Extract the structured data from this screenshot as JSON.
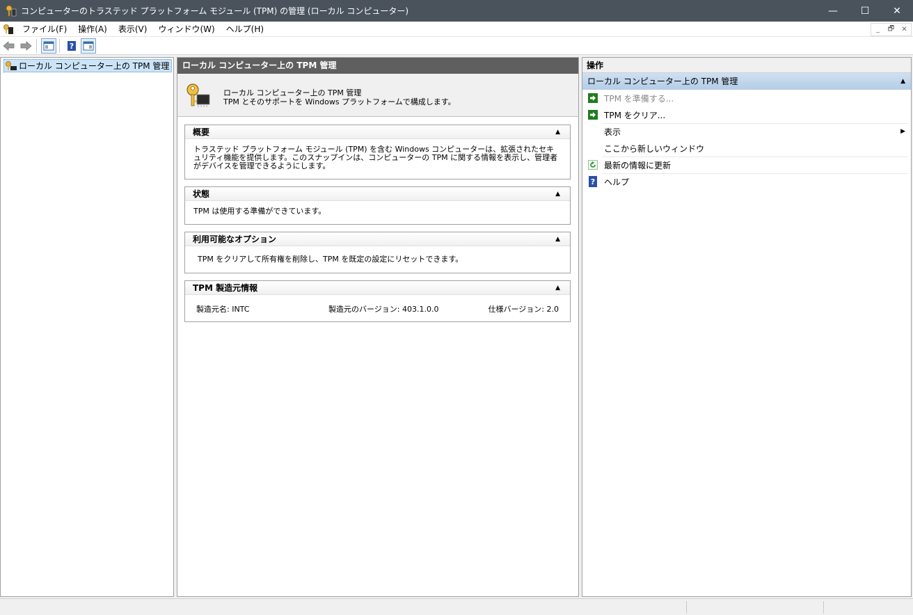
{
  "window": {
    "title": "コンピューターのトラステッド プラットフォーム モジュール (TPM) の管理 (ローカル コンピューター)",
    "minimize": "—",
    "maximize": "☐",
    "close": "✕"
  },
  "menu": {
    "items": [
      {
        "label": "ファイル(F)"
      },
      {
        "label": "操作(A)"
      },
      {
        "label": "表示(V)"
      },
      {
        "label": "ウィンドウ(W)"
      },
      {
        "label": "ヘルプ(H)"
      }
    ],
    "mdi_minimize": "_",
    "mdi_restore": "🗗",
    "mdi_close": "✕"
  },
  "toolbar": {
    "icons": [
      "back-arrow-icon",
      "forward-arrow-icon",
      "show-hide-console-tree-icon",
      "help-icon",
      "show-hide-action-pane-icon"
    ]
  },
  "tree": {
    "root_label": "ローカル コンピューター上の TPM 管理"
  },
  "center": {
    "header": "ローカル コンピューター上の TPM 管理",
    "intro_line1": "ローカル コンピューター上の TPM 管理",
    "intro_line2": "TPM とそのサポートを Windows プラットフォームで構成します。",
    "sections": {
      "overview": {
        "title": "概要",
        "body": "トラステッド プラットフォーム モジュール (TPM) を含む Windows コンピューターは、拡張されたセキュリティ機能を提供します。このスナップインは、コンピューターの TPM に関する情報を表示し、管理者がデバイスを管理できるようにします。"
      },
      "status": {
        "title": "状態",
        "body": "TPM は使用する準備ができています。"
      },
      "options": {
        "title": "利用可能なオプション",
        "body": "TPM をクリアして所有権を削除し、TPM を既定の設定にリセットできます。"
      },
      "manufacturer": {
        "title": "TPM 製造元情報",
        "name": "製造元名: INTC",
        "version": "製造元のバージョン: 403.1.0.0",
        "spec": "仕様バージョン: 2.0"
      }
    }
  },
  "actions": {
    "header": "操作",
    "group_label": "ローカル コンピューター上の TPM 管理",
    "items": [
      {
        "label": "TPM を準備する...",
        "disabled": true
      },
      {
        "label": "TPM をクリア..."
      },
      {
        "label": "表示"
      },
      {
        "label": "ここから新しいウィンドウ"
      },
      {
        "label": "最新の情報に更新"
      },
      {
        "label": "ヘルプ"
      }
    ]
  },
  "colors": {
    "titlebar": "#4a535c",
    "center_header": "#5f5f5f",
    "action_group": "#b4cce7",
    "action_arrow_green": "#1e7d1e"
  }
}
